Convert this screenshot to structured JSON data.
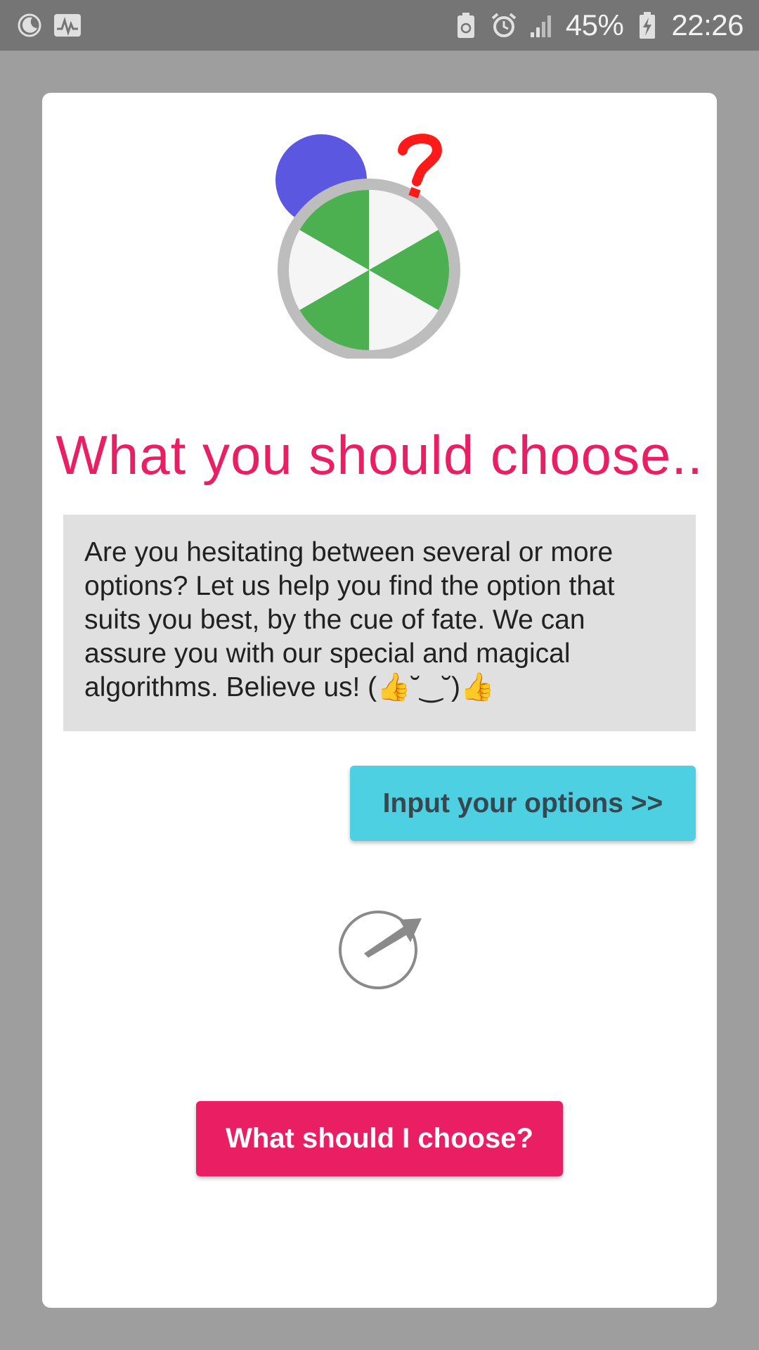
{
  "status_bar": {
    "battery": "45%",
    "time": "22:26",
    "icons_left": [
      "moon-icon",
      "pulse-icon"
    ],
    "icons_right": [
      "battery-saver-icon",
      "alarm-icon",
      "signal-icon",
      "battery-charging-icon"
    ]
  },
  "main": {
    "logo": "wheel-question-logo",
    "title": "What you should choose..",
    "description": "Are you hesitating between several or more options? Let us help you find the option that suits you best, by the cue of fate. We can assure you with our special and magical algorithms. Believe us! (👍˘‿˘)👍",
    "input_button_label": "Input your options >>",
    "result_text": "...",
    "choose_button_label": "What should I choose?"
  },
  "colors": {
    "accent": "#e91e63",
    "button_cyan": "#4dd0e1",
    "wheel_green": "#4caf50",
    "blob_blue": "#5b57e0"
  }
}
